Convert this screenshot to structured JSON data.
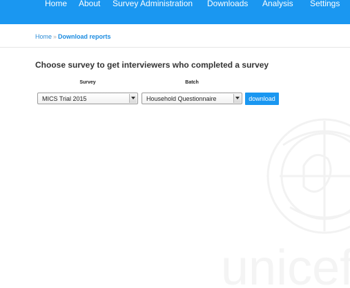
{
  "nav": {
    "items": [
      {
        "label": "Home"
      },
      {
        "label": "About"
      },
      {
        "label": "Survey Administration"
      },
      {
        "label": "Downloads"
      },
      {
        "label": "Analysis"
      },
      {
        "label": "Settings"
      }
    ]
  },
  "breadcrumb": {
    "home": "Home",
    "separator": "»",
    "current": "Download reports"
  },
  "main": {
    "heading": "Choose survey to get interviewers who completed a survey",
    "survey_label": "Survey",
    "survey_value": "MICS Trial 2015",
    "batch_label": "Batch",
    "batch_value": "Household Questionnaire",
    "download_label": "download"
  },
  "watermark": {
    "text": "unicef"
  },
  "colors": {
    "brand": "#1a97f1",
    "link": "#1a8be0",
    "heading": "#333333"
  }
}
